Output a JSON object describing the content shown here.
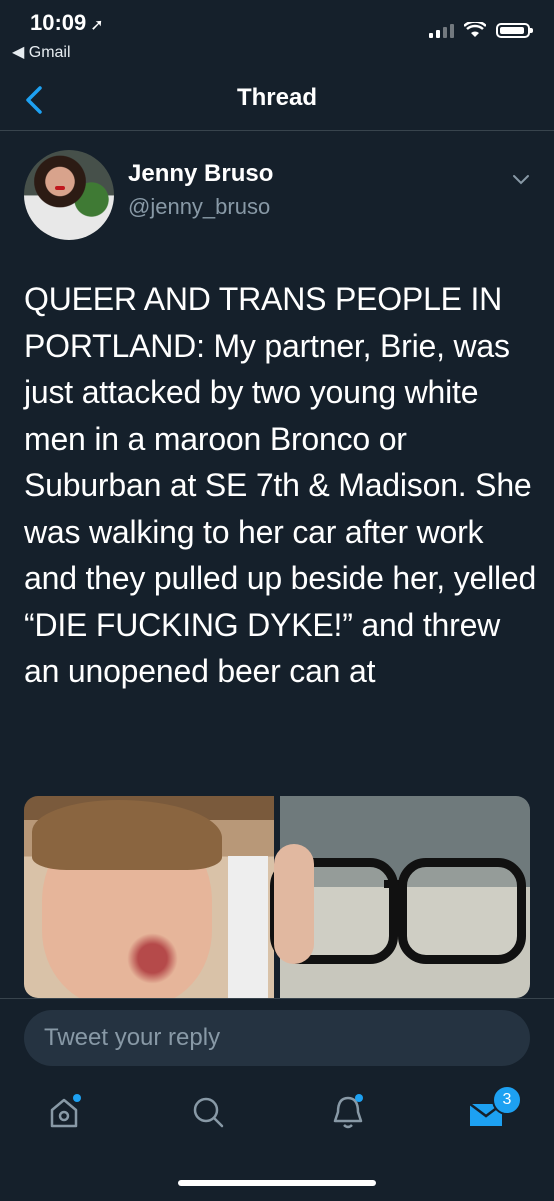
{
  "status": {
    "time": "10:09",
    "back_app": "◀ Gmail"
  },
  "nav": {
    "title": "Thread"
  },
  "tweet": {
    "name": "Jenny Bruso",
    "handle": "@jenny_bruso",
    "text": "QUEER AND TRANS PEOPLE IN PORTLAND: My partner, Brie, was just attacked by two young white men in a maroon Bronco or Suburban at SE 7th & Madison. She was walking to her car after work and they pulled up beside her, yelled “DIE FUCKING DYKE!” and threw an unopened beer can at"
  },
  "reply": {
    "placeholder": "Tweet your reply"
  },
  "tabs": {
    "messages_badge": "3"
  },
  "colors": {
    "background": "#15202b",
    "accent": "#1da1f2",
    "muted": "#8899a6"
  }
}
